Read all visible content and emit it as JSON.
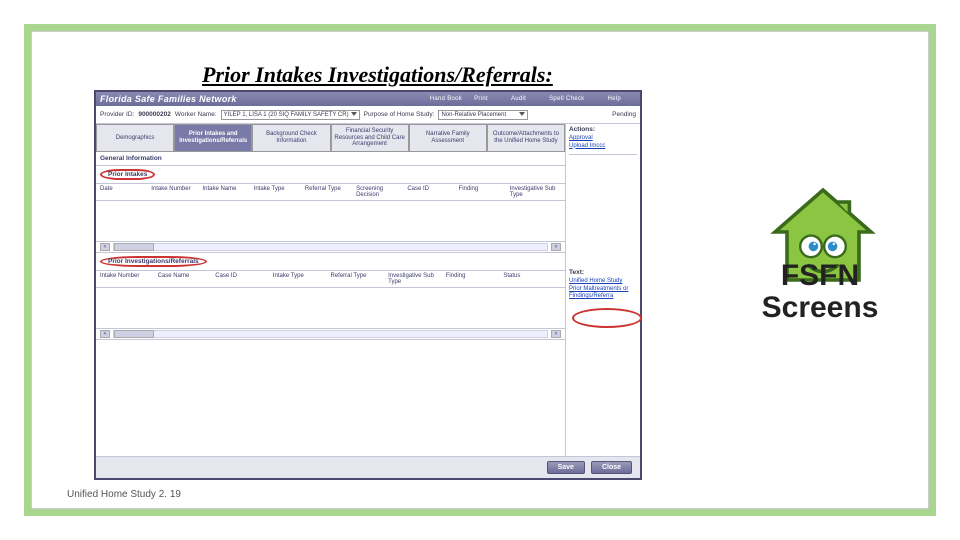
{
  "slide": {
    "title": "Prior Intakes Investigations/Referrals:",
    "big_label": "FSFN Screens",
    "footer": "Unified Home Study 2. 19"
  },
  "app": {
    "title": "Florida Safe Families Network",
    "toolbar": {
      "handbook": "Hand Book",
      "print": "Print",
      "audit": "Audit",
      "spellcheck": "Spell Check",
      "help": "Help"
    },
    "info": {
      "provider_label": "Provider ID:",
      "provider_id": "900000202",
      "worker_label": "Worker Name:",
      "worker_name": "YILEP 1, LISA 1 (20 SIQ FAMILY SAFETY CR)",
      "purpose_label": "Purpose of Home Study:",
      "purpose": "Non-Relative Placement",
      "status": "Pending"
    },
    "tabs": [
      "Demographics",
      "Prior Intakes and Investigations/Referrals",
      "Background Check Information",
      "Financial Security Resources and Child Care Arrangement",
      "Narrative Family Assessment",
      "Outcome/Attachments to the Unified Home Study"
    ],
    "actions": {
      "head": "Actions:",
      "approval": "Approval",
      "upload": "Upload Imccc",
      "text_head": "Text:",
      "link_uhs": "Unified Home Study",
      "link_prior": "Prior Maltreatments or Findings/Referra"
    },
    "sections": {
      "sect1": {
        "title": "Prior Intakes",
        "cols": [
          "Date",
          "Intake Number",
          "Intake Name",
          "Intake Type",
          "Referral Type",
          "Screening Decision",
          "Case ID",
          "Finding",
          "Investigative Sub Type"
        ]
      },
      "sect2": {
        "title": "Prior Investigations/Referrals",
        "cols": [
          "Intake Number",
          "Case Name",
          "Case ID",
          "Intake Type",
          "Referral Type",
          "Investigative Sub Type",
          "Finding",
          "Status"
        ]
      },
      "general_info": "General Information"
    },
    "buttons": {
      "save": "Save",
      "close": "Close"
    },
    "scroll": {
      "left": "<",
      "right": ">"
    }
  }
}
